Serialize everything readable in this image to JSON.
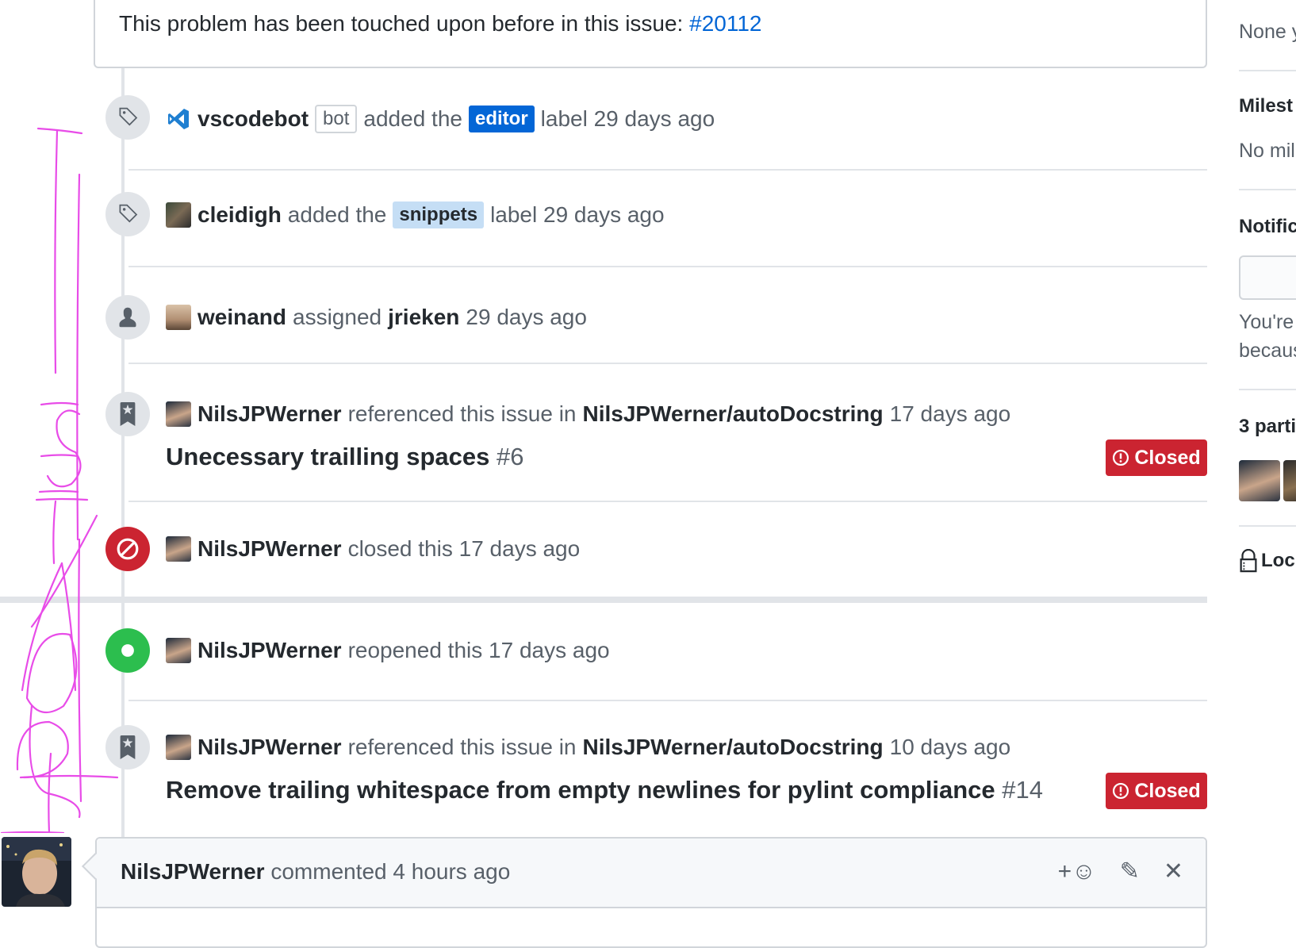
{
  "top_comment": {
    "text": "This problem has been touched upon before in this issue: ",
    "link": "#20112"
  },
  "events": [
    {
      "icon": "tag-icon",
      "actor": "vscodebot",
      "actor_tag": "bot",
      "verb": "added the",
      "label": "editor",
      "after": "label 29 days ago"
    },
    {
      "icon": "tag-icon",
      "actor": "cleidigh",
      "verb": "added the",
      "label": "snippets",
      "after": "label 29 days ago"
    },
    {
      "icon": "person-icon",
      "actor": "weinand",
      "verb": "assigned",
      "target": "jrieken",
      "after": "29 days ago"
    },
    {
      "icon": "bookmark-icon",
      "actor": "NilsJPWerner",
      "verb": "referenced this issue in",
      "repo": "NilsJPWerner/autoDocstring",
      "after": "17 days ago",
      "ref_title": "Unecessary trailling spaces",
      "ref_num": "#6",
      "status": "Closed"
    },
    {
      "icon": "circle-slash-icon",
      "actor": "NilsJPWerner",
      "verb": "closed this 17 days ago"
    },
    {
      "icon": "dot-icon",
      "actor": "NilsJPWerner",
      "verb": "reopened this 17 days ago"
    },
    {
      "icon": "bookmark-icon",
      "actor": "NilsJPWerner",
      "verb": "referenced this issue in",
      "repo": "NilsJPWerner/autoDocstring",
      "after": "10 days ago",
      "ref_title": "Remove trailing whitespace from empty newlines for pylint compliance",
      "ref_num": "#14",
      "status": "Closed"
    }
  ],
  "comment": {
    "author": "NilsJPWerner",
    "meta": "commented 4 hours ago",
    "actions": {
      "reaction": "+☺",
      "edit": "✎",
      "delete": "✕"
    }
  },
  "sidebar": {
    "assignees_text": "None y",
    "milestone_head": "Milest",
    "milestone_text": "No mil",
    "notifications_head": "Notific",
    "notify_line1": "You're",
    "notify_line2": "becaus",
    "participants_head": "3 parti",
    "lock_text": "Loc"
  },
  "annotation_text": "UPDATES",
  "colors": {
    "link": "#0366d6",
    "closed": "#cb2431",
    "open": "#2cbe4e",
    "label_editor": "#0366d6",
    "label_snippets": "#c5def5",
    "annotation": "#e84ce8"
  }
}
